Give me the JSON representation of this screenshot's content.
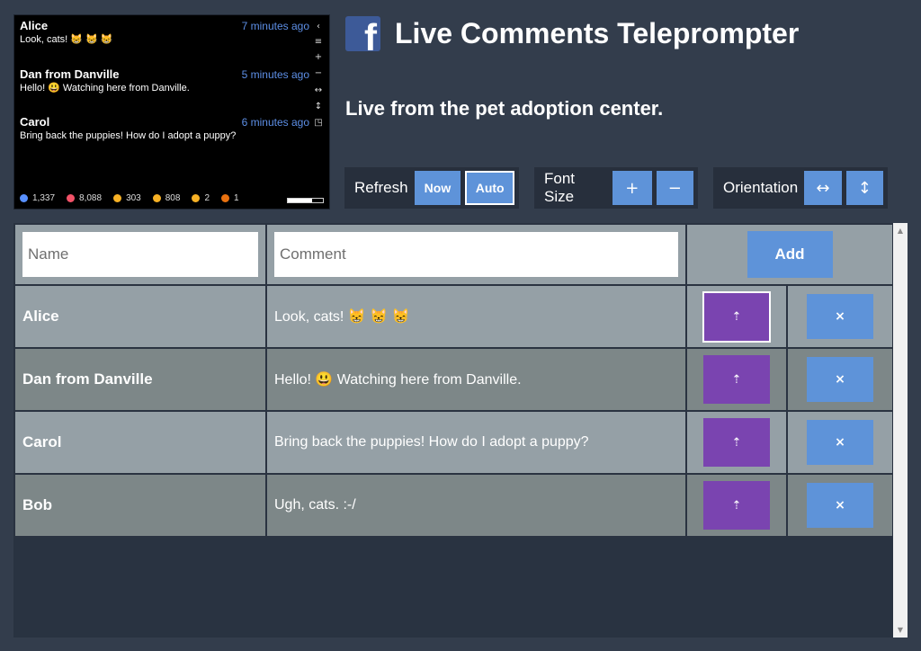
{
  "preview": {
    "comments": [
      {
        "name": "Alice",
        "time": "7 minutes ago",
        "text": "Look, cats! 😸 😸 😸"
      },
      {
        "name": "Dan from Danville",
        "time": "5 minutes ago",
        "text": "Hello! 😃 Watching here from Danville."
      },
      {
        "name": "Carol",
        "time": "6 minutes ago",
        "text": "Bring back the puppies! How do I adopt a puppy?"
      }
    ],
    "controls": {
      "collapse": "‹",
      "menu": "≡",
      "plus": "+",
      "minus": "−",
      "horizontal": "↔",
      "vertical": "↕",
      "window": "◳"
    },
    "reactions": [
      {
        "icon": "like-icon",
        "count": "1,337",
        "color": "#5890ff"
      },
      {
        "icon": "love-icon",
        "count": "8,088",
        "color": "#f25268"
      },
      {
        "icon": "haha-icon",
        "count": "303",
        "color": "#f7b125"
      },
      {
        "icon": "wow-icon",
        "count": "808",
        "color": "#f7b125"
      },
      {
        "icon": "sad-icon",
        "count": "2",
        "color": "#f7b125"
      },
      {
        "icon": "angry-icon",
        "count": "1",
        "color": "#e9710f"
      }
    ],
    "progress": 0.7
  },
  "header": {
    "logo_glyph": "f",
    "title": "Live Comments Teleprompter",
    "subtitle": "Live from the pet adoption center."
  },
  "controls": {
    "refresh": {
      "label": "Refresh",
      "now": "Now",
      "auto": "Auto"
    },
    "font_size": {
      "label": "Font Size",
      "plus": "+",
      "minus": "−"
    },
    "orientation": {
      "label": "Orientation",
      "horizontal": "↔",
      "vertical": "↕"
    }
  },
  "form": {
    "name_placeholder": "Name",
    "comment_placeholder": "Comment",
    "add_label": "Add"
  },
  "rows": [
    {
      "name": "Alice",
      "comment": "Look, cats! 😸 😸 😸"
    },
    {
      "name": "Dan from Danville",
      "comment": "Hello!  😃  Watching here from Danville."
    },
    {
      "name": "Carol",
      "comment": "Bring back the puppies!  How do I adopt a puppy?"
    },
    {
      "name": "Bob",
      "comment": "Ugh, cats. :-/"
    }
  ],
  "row_actions": {
    "push_glyph": "⇡",
    "delete_glyph": "×"
  },
  "scrollbar": {
    "up": "▲",
    "down": "▼"
  },
  "colors": {
    "background": "#333d4c",
    "accent": "#5e93d9",
    "push": "#7a44b0",
    "facebook": "#3d5a98"
  }
}
